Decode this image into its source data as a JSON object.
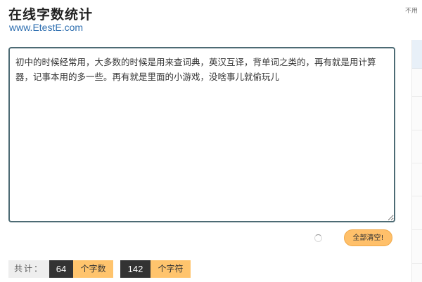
{
  "header": {
    "title": "在线字数统计",
    "site": "www.EtestE.com",
    "top_right_note": "不用"
  },
  "editor": {
    "value": "初中的时候经常用，大多数的时候是用来查词典，英汉互译，背单词之类的，再有就是用计算器，记事本用的多一些。再有就是里面的小游戏，没啥事儿就偷玩儿"
  },
  "actions": {
    "clear_label": "全部清空!"
  },
  "stats": {
    "total_label": "共计：",
    "word_count": "64",
    "word_unit": "个字数",
    "char_count": "142",
    "char_unit": "个字符"
  },
  "colors": {
    "accent": "#ffc06a",
    "dark": "#333333",
    "link": "#2f6fb0",
    "textarea_border": "#4d6b74"
  }
}
